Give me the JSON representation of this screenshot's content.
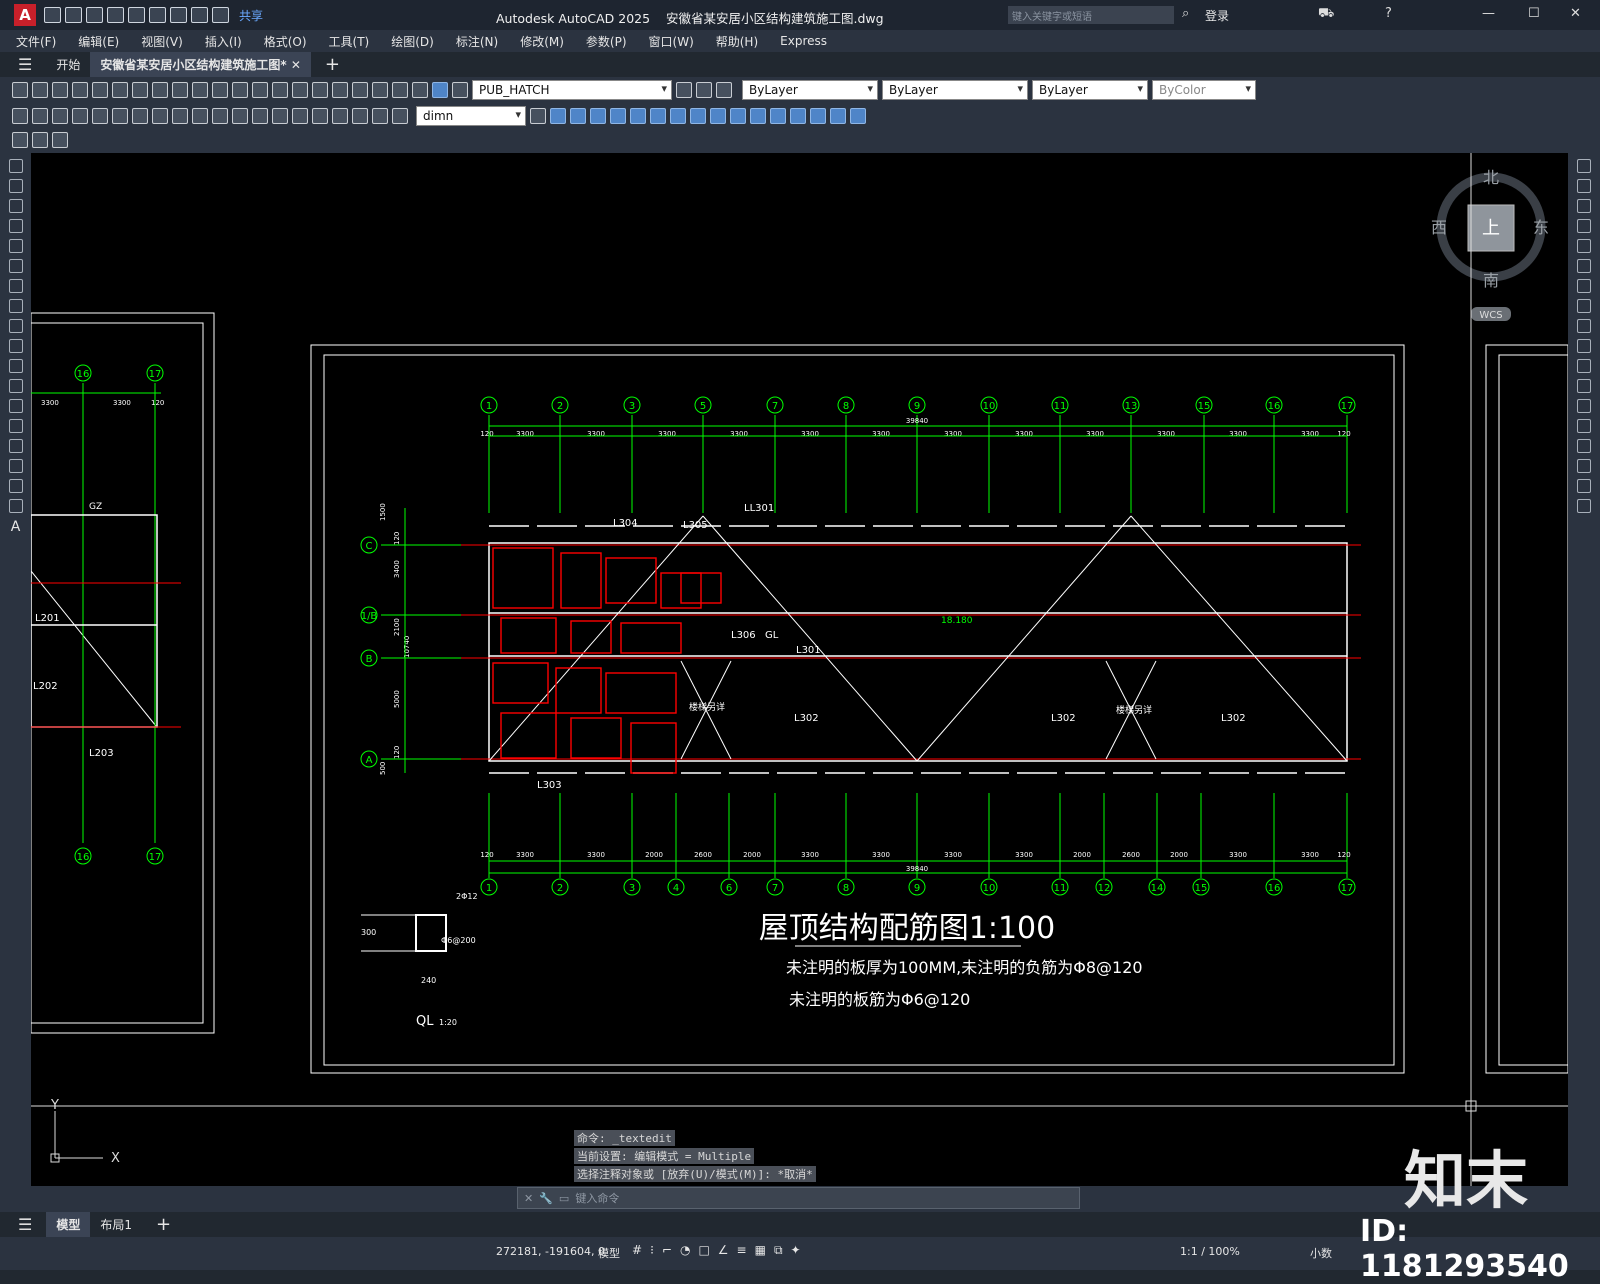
{
  "titlebar": {
    "app_title": "Autodesk AutoCAD 2025",
    "file_title": "安徽省某安居小区结构建筑施工图.dwg",
    "search_placeholder": "键入关键字或短语",
    "login": "登录",
    "share": "共享"
  },
  "menubar": {
    "items": [
      "文件(F)",
      "编辑(E)",
      "视图(V)",
      "插入(I)",
      "格式(O)",
      "工具(T)",
      "绘图(D)",
      "标注(N)",
      "修改(M)",
      "参数(P)",
      "窗口(W)",
      "帮助(H)",
      "Express"
    ]
  },
  "tabs": [
    {
      "label": "开始"
    },
    {
      "label": "安徽省某安居小区结构建筑施工图*"
    }
  ],
  "toolbar": {
    "layer": "PUB_HATCH",
    "color": "ByLayer",
    "linetype": "ByLayer",
    "lineweight": "ByLayer",
    "plotstyle": "ByColor",
    "dimstyle": "dimn"
  },
  "viewcube": {
    "north": "北",
    "south": "南",
    "east": "东",
    "west": "西",
    "top": "上",
    "wcs": "WCS"
  },
  "drawing": {
    "title": "屋顶结构配筋图1:100",
    "note1": "未注明的板厚为100MM,未注明的负筋为Φ8@120",
    "note2": "未注明的板筋为Φ6@120",
    "top_total": "39840",
    "bottom_total": "39840",
    "top_axes": [
      "1",
      "2",
      "3",
      "5",
      "7",
      "8",
      "9",
      "10",
      "11",
      "13",
      "15",
      "16",
      "17"
    ],
    "bottom_axes": [
      "1",
      "2",
      "3",
      "4",
      "6",
      "7",
      "8",
      "9",
      "10",
      "11",
      "12",
      "14",
      "15",
      "16",
      "17"
    ],
    "row_axes": [
      "C",
      "1/B",
      "B",
      "A"
    ],
    "top_dims": [
      "120",
      "3300",
      "3300",
      "3300",
      "3300",
      "3300",
      "3300",
      "3300",
      "3300",
      "3300",
      "3300",
      "3300",
      "3300",
      "120"
    ],
    "bottom_dims": [
      "120",
      "3300",
      "3300",
      "2000",
      "2600",
      "2000",
      "3300",
      "3300",
      "3300",
      "3300",
      "2000",
      "2600",
      "2000",
      "3300",
      "3300",
      "120"
    ],
    "side_dims": [
      "1500",
      "120",
      "3400",
      "2100",
      "5000",
      "120",
      "500",
      "10740"
    ],
    "elev": "18.180",
    "stair": "楼梯另详",
    "beam_labels": [
      "L304",
      "L305",
      "LL301",
      "L306",
      "GL",
      "L301",
      "L302",
      "L303"
    ],
    "ql_label": "QL",
    "ql_scale": "1:20",
    "ql_dims": [
      "300",
      "240",
      "2Φ12",
      "Φ6@200"
    ],
    "left_axes": [
      "16",
      "17"
    ],
    "left_dims": [
      "3300",
      "3300",
      "120"
    ],
    "left_labels": [
      "L201",
      "L202",
      "L203",
      "GZ"
    ]
  },
  "command": {
    "history": [
      "命令: _textedit",
      "当前设置: 编辑模式 = Multiple",
      "选择注释对象或 [放弃(U)/模式(M)]: *取消*"
    ],
    "placeholder": "键入命令"
  },
  "layouts": [
    {
      "label": "模型"
    },
    {
      "label": "布局1"
    }
  ],
  "status": {
    "coords": "272181, -191604, 0",
    "model": "模型",
    "scale": "1:1 / 100%",
    "units": "小数"
  },
  "watermark": {
    "brand": "知末",
    "id": "ID: 1181293540"
  }
}
